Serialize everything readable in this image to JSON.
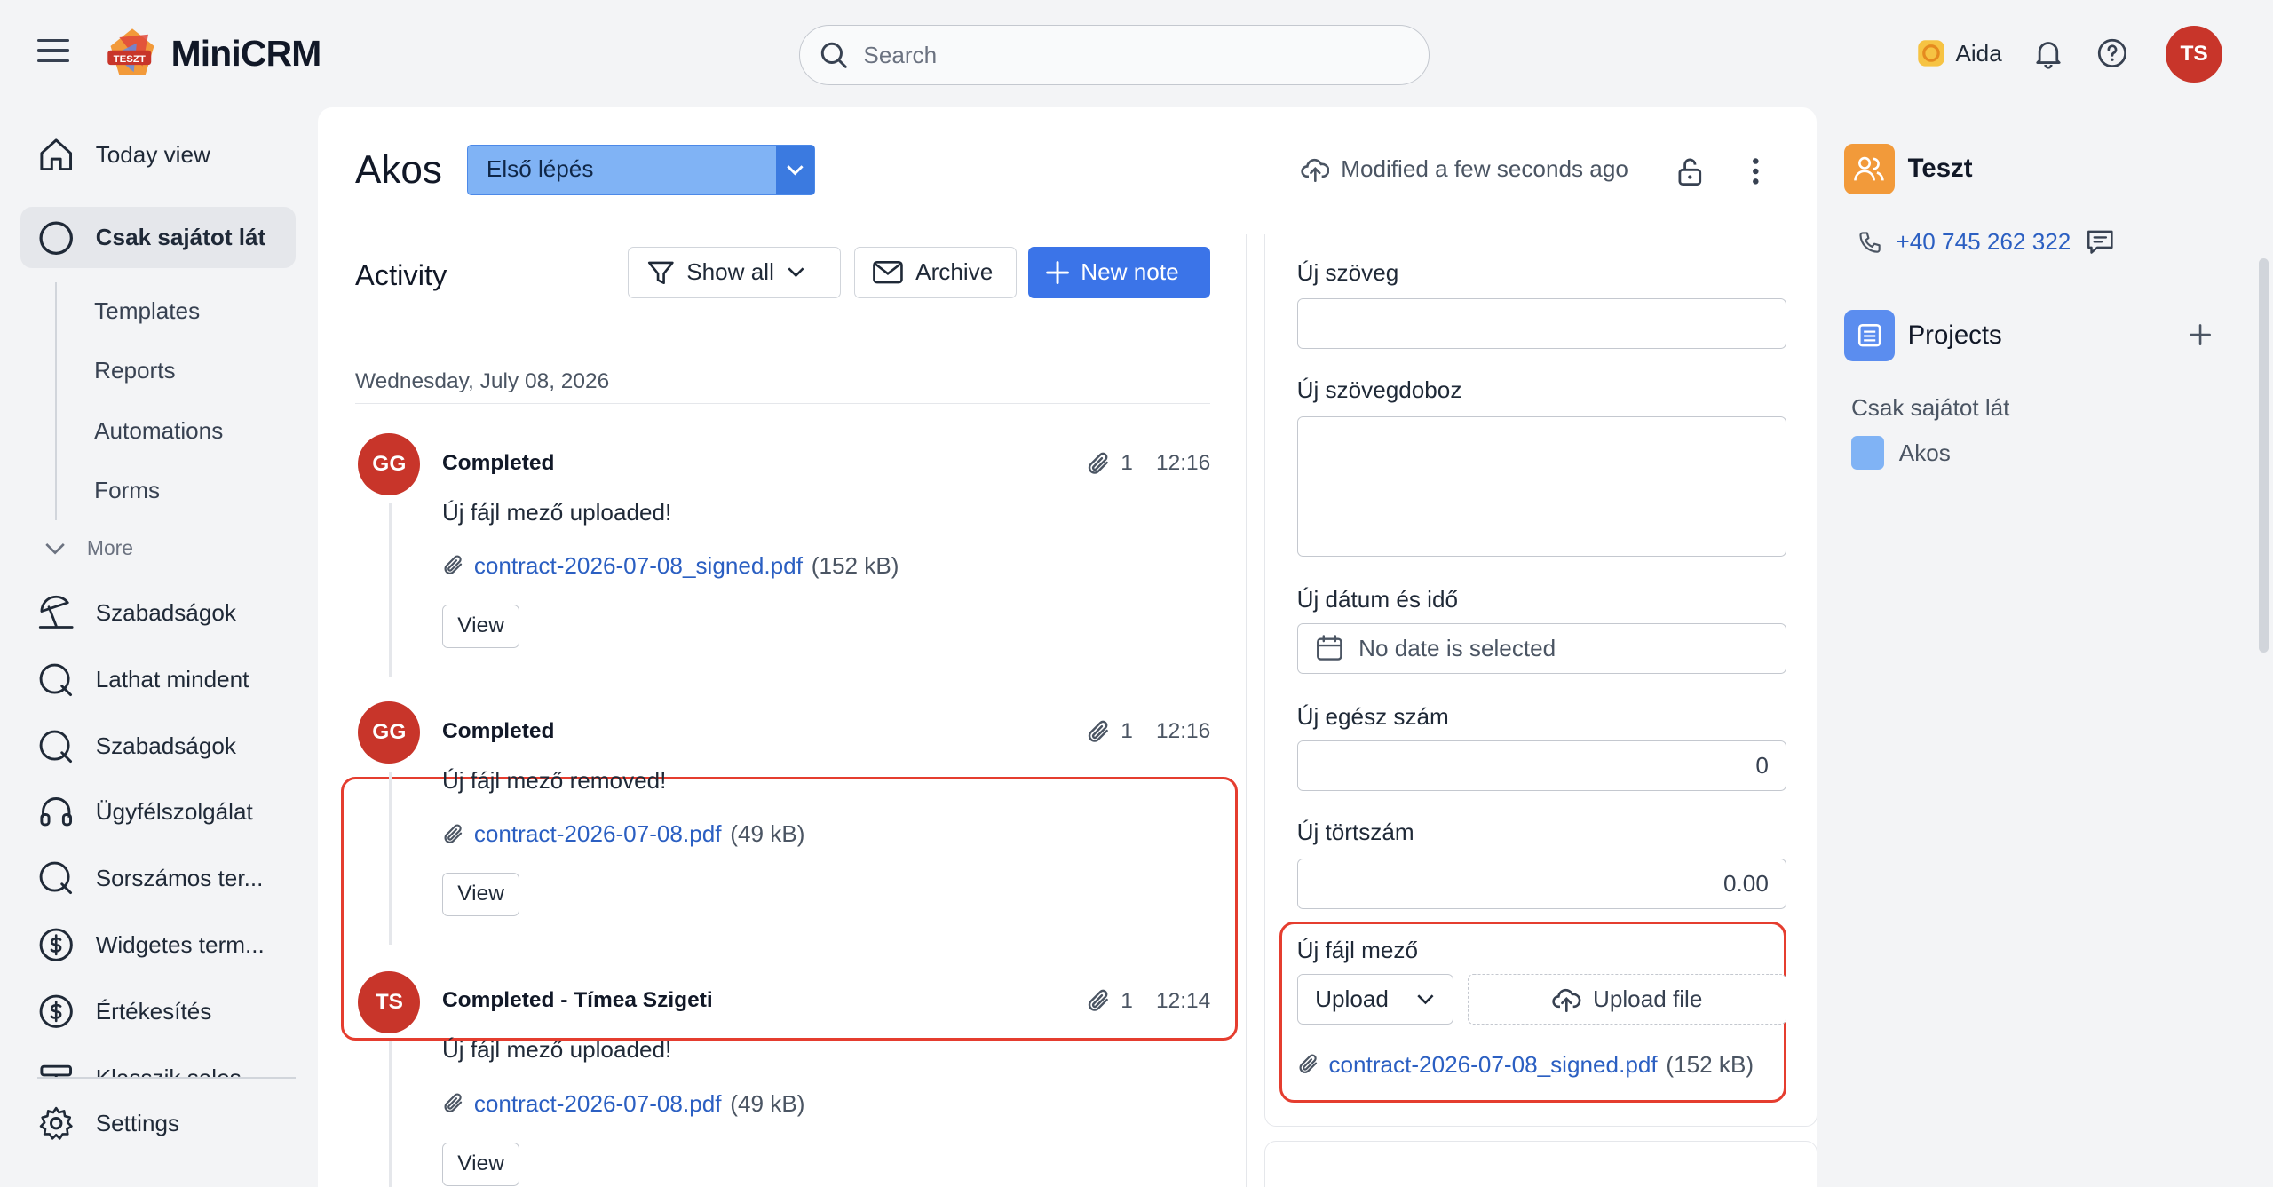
{
  "app": {
    "name": "MiniCRM",
    "logo_badge": "TESZT",
    "search_placeholder": "Search",
    "aida_label": "Aida",
    "user_initials": "TS"
  },
  "sidebar": {
    "items": [
      {
        "label": "Today view",
        "icon": "home-icon"
      },
      {
        "label": "Csak sajátot lát",
        "icon": "circle-icon",
        "active": true
      }
    ],
    "sub_items": [
      "Templates",
      "Reports",
      "Automations",
      "Forms"
    ],
    "more_label": "More",
    "modules": [
      {
        "label": "Szabadságok",
        "icon": "beach-umbrella-icon"
      },
      {
        "label": "Lathat mindent",
        "icon": "search-circle-icon"
      },
      {
        "label": "Szabadságok",
        "icon": "search-circle-icon"
      },
      {
        "label": "Ügyfélszolgálat",
        "icon": "headset-icon"
      },
      {
        "label": "Sorszámos ter...",
        "icon": "search-circle-icon"
      },
      {
        "label": "Widgetes term...",
        "icon": "dollar-icon"
      },
      {
        "label": "Értékesítés",
        "icon": "dollar-icon"
      },
      {
        "label": "Klasszik sales...",
        "icon": "sign-icon"
      }
    ],
    "settings_label": "Settings"
  },
  "record": {
    "title": "Akos",
    "stage": "Első lépés",
    "modified": "Modified a few seconds ago"
  },
  "activity": {
    "title": "Activity",
    "filter_label": "Show all",
    "archive_label": "Archive",
    "new_note_label": "New note",
    "date_heading": "Wednesday, July 08, 2026",
    "entries": [
      {
        "initials": "GG",
        "title": "Completed",
        "attachments": "1",
        "time": "12:16",
        "message": "Új fájl mező uploaded!",
        "file": "contract-2026-07-08_signed.pdf",
        "size": "(152 kB)",
        "view_label": "View"
      },
      {
        "initials": "GG",
        "title": "Completed",
        "attachments": "1",
        "time": "12:16",
        "message": "Új fájl mező removed!",
        "file": "contract-2026-07-08.pdf",
        "size": "(49 kB)",
        "view_label": "View"
      },
      {
        "initials": "TS",
        "title": "Completed - Tímea Szigeti",
        "attachments": "1",
        "time": "12:14",
        "message": "Új fájl mező uploaded!",
        "file": "contract-2026-07-08.pdf",
        "size": "(49 kB)",
        "view_label": "View"
      }
    ]
  },
  "fields": {
    "text_label": "Új szöveg",
    "text_value": "",
    "textarea_label": "Új szövegdoboz",
    "textarea_value": "",
    "datetime_label": "Új dátum és idő",
    "datetime_placeholder": "No date is selected",
    "integer_label": "Új egész szám",
    "integer_value": "0",
    "decimal_label": "Új törtszám",
    "decimal_value": "0.00",
    "file_label": "Új fájl mező",
    "upload_select": "Upload",
    "upload_button": "Upload file",
    "file_name": "contract-2026-07-08_signed.pdf",
    "file_size": "(152 kB)"
  },
  "right_panel": {
    "contact_name": "Teszt",
    "phone": "+40 745 262 322",
    "projects_title": "Projects",
    "projects_group": "Csak sajátot lát",
    "project_name": "Akos"
  },
  "colors": {
    "accent": "#3b74e8",
    "avatar_red": "#c8352a",
    "highlight_red": "#e53d2f",
    "stage_blue": "#80b3f5",
    "contact_orange": "#f29a3a",
    "project_blue": "#5b8def"
  }
}
